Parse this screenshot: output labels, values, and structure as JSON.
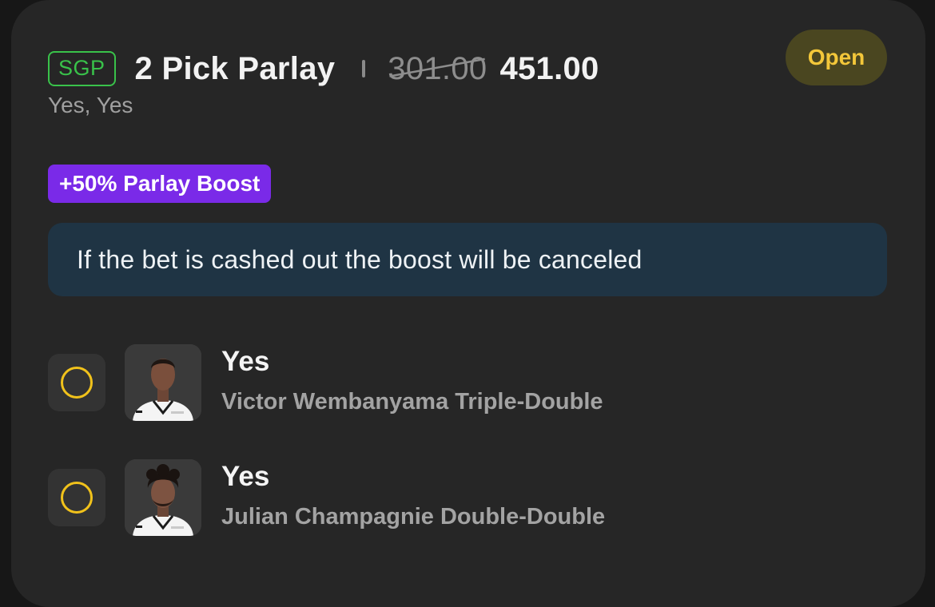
{
  "bet": {
    "type_badge": "SGP",
    "title": "2 Pick Parlay",
    "original_odds": "301.00",
    "boosted_odds": "451.00",
    "status": "Open",
    "summary": "Yes, Yes",
    "boost_label": "+50% Parlay Boost",
    "notice": "If the bet is cashed out the boost will be canceled"
  },
  "picks": [
    {
      "selection": "Yes",
      "market": "Victor Wembanyama Triple-Double",
      "avatar": "player-headshot"
    },
    {
      "selection": "Yes",
      "market": "Julian Champagnie Double-Double",
      "avatar": "player-headshot"
    }
  ],
  "colors": {
    "sgp_green": "#39c24a",
    "status_yellow": "#f3c73a",
    "boost_purple": "#7a2ae8",
    "notice_bg": "#1f3444",
    "pick_ring": "#f1c21b"
  }
}
